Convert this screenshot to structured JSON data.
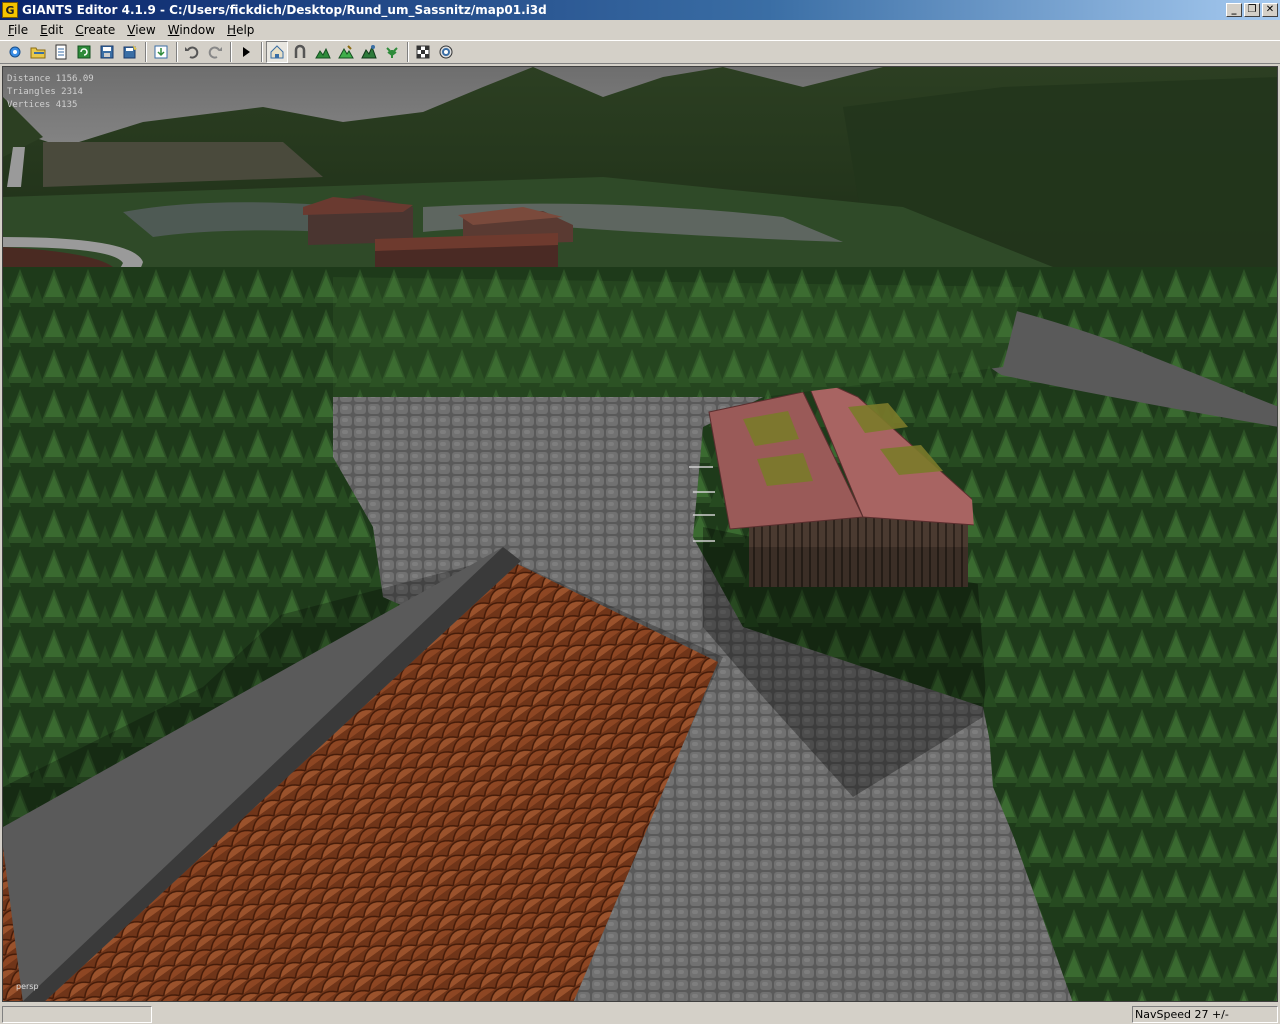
{
  "window": {
    "title": "GIANTS Editor 4.1.9 - C:/Users/fickdich/Desktop/Rund_um_Sassnitz/map01.i3d",
    "app_icon_letter": "G"
  },
  "menu": [
    {
      "ul": "F",
      "rest": "ile"
    },
    {
      "ul": "E",
      "rest": "dit"
    },
    {
      "ul": "C",
      "rest": "reate"
    },
    {
      "ul": "V",
      "rest": "iew"
    },
    {
      "ul": "W",
      "rest": "indow"
    },
    {
      "ul": "H",
      "rest": "elp"
    }
  ],
  "toolbar": {
    "icons": [
      "new-icon",
      "open-icon",
      "list-icon",
      "reload-icon",
      "save-icon",
      "save-as-icon",
      "import-icon",
      "undo-icon",
      "redo-icon",
      "play-icon",
      "select-mode-icon",
      "move-mode-icon",
      "terrain-sculpt-icon",
      "terrain-paint-icon",
      "foliage-paint-icon",
      "plant-paint-icon",
      "render-icon",
      "settings-icon"
    ]
  },
  "viewport": {
    "stats": [
      "Distance 1156.09",
      "Triangles 2314",
      "Vertices 4135"
    ],
    "camera_label": "persp"
  },
  "status": {
    "navspeed": "NavSpeed 27 +/-"
  }
}
